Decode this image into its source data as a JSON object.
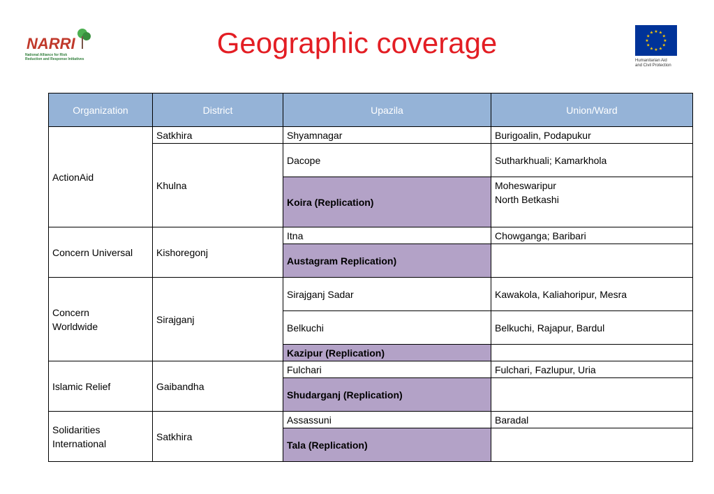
{
  "logo_left": {
    "text": "NARRI",
    "caption_line1": "National Alliance for Risk",
    "caption_line2": "Reduction and Response Initiatives"
  },
  "title": "Geographic coverage",
  "eu_logo": {
    "caption_line1": "Humanitarian Aid",
    "caption_line2": "and Civil Protection"
  },
  "table": {
    "headers": [
      "Organization",
      "District",
      "Upazila",
      "Union/Ward"
    ],
    "orgs": [
      {
        "name": "ActionAid",
        "districts": [
          {
            "name": "Satkhira",
            "upazilas": [
              {
                "name": "Shyamnagar",
                "union": [
                  "Burigoalin, Podapukur"
                ]
              }
            ]
          },
          {
            "name": "Khulna",
            "upazilas": [
              {
                "name": "Dacope",
                "union": [
                  "Sutharkhuali; Kamarkhola"
                ]
              },
              {
                "name": "Koira (Replication)",
                "union": [
                  "Moheswaripur",
                  "North Betkashi"
                ]
              }
            ]
          }
        ]
      },
      {
        "name": "Concern Universal",
        "districts": [
          {
            "name": "Kishoregonj",
            "upazilas": [
              {
                "name": "Itna",
                "union": [
                  "Chowganga; Baribari"
                ]
              },
              {
                "name": "Austagram  Replication)",
                "union": []
              }
            ]
          }
        ]
      },
      {
        "name_line1": "Concern",
        "name_line2": "Worldwide",
        "districts": [
          {
            "name": "Sirajganj",
            "upazilas": [
              {
                "name": "Sirajganj Sadar",
                "union": [
                  "Kawakola, Kaliahoripur, Mesra"
                ]
              },
              {
                "name": "Belkuchi",
                "union": [
                  "Belkuchi, Rajapur, Bardul"
                ]
              },
              {
                "name": "Kazipur (Replication)",
                "union": []
              }
            ]
          }
        ]
      },
      {
        "name": "Islamic Relief",
        "districts": [
          {
            "name": "Gaibandha",
            "upazilas": [
              {
                "name": "Fulchari",
                "union": [
                  "Fulchari, Fazlupur, Uria"
                ]
              },
              {
                "name": "Shudarganj (Replication)",
                "union": []
              }
            ]
          }
        ]
      },
      {
        "name_line1": "Solidarities",
        "name_line2": "International",
        "districts": [
          {
            "name": "Satkhira",
            "upazilas": [
              {
                "name": "Assassuni",
                "union": [
                  "Baradal"
                ]
              },
              {
                "name": "Tala (Replication)",
                "union": []
              }
            ]
          }
        ]
      }
    ]
  },
  "colors": {
    "title": "#e31e24",
    "header_bg": "#95b3d7",
    "replication_bg": "#b3a2c7",
    "eu_blue": "#003399",
    "eu_star": "#ffcc00"
  }
}
